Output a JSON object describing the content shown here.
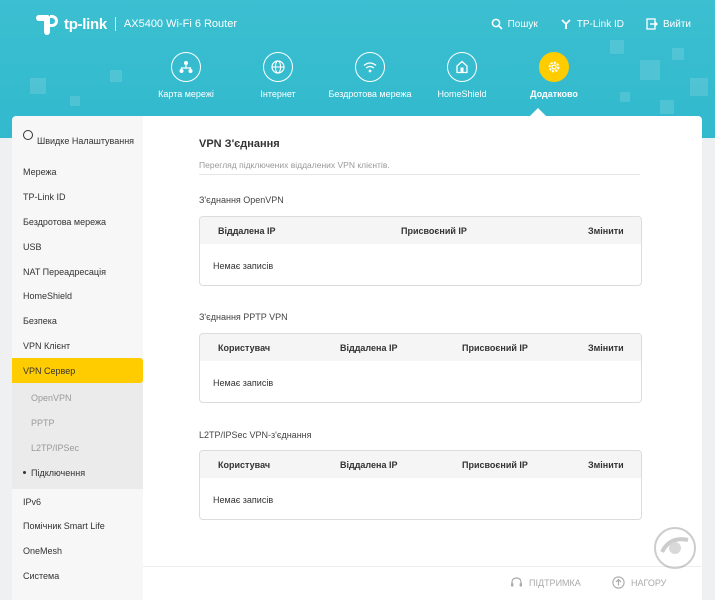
{
  "header": {
    "brand": "tp-link",
    "model": "AX5400 Wi-Fi 6 Router",
    "top_links": [
      {
        "label": "Пошук",
        "icon": "search-icon"
      },
      {
        "label": "TP-Link ID",
        "icon": "tplink-id-icon"
      },
      {
        "label": "Вийти",
        "icon": "logout-icon"
      }
    ],
    "nav": [
      {
        "label": "Карта мережі",
        "icon": "network-map-icon",
        "active": false
      },
      {
        "label": "Інтернет",
        "icon": "globe-icon",
        "active": false
      },
      {
        "label": "Бездротова мережа",
        "icon": "wifi-icon",
        "active": false
      },
      {
        "label": "HomeShield",
        "icon": "homeshield-icon",
        "active": false
      },
      {
        "label": "Додатково",
        "icon": "gear-icon",
        "active": true
      }
    ],
    "colors": {
      "header_bg": "#32b9cd",
      "accent": "#ffcc00"
    }
  },
  "sidebar": {
    "quick_setup": "Швидке Налаштування",
    "items_top": [
      "Мережа",
      "TP-Link ID",
      "Бездротова мережа",
      "USB",
      "NAT Переадресація",
      "HomeShield",
      "Безпека",
      "VPN Клієнт"
    ],
    "active_item": "VPN Сервер",
    "sub_items": [
      "OpenVPN",
      "PPTP",
      "L2TP/IPSec"
    ],
    "current_sub": "Підключення",
    "items_bottom": [
      "IPv6",
      "Помічник Smart Life",
      "OneMesh",
      "Система"
    ]
  },
  "main": {
    "title": "VPN З'єднання",
    "description": "Перегляд підключених віддалених VPN клієнтів.",
    "sections": [
      {
        "label": "З'єднання OpenVPN",
        "columns": [
          "Віддалена IP",
          "Присвоєний IP",
          "Змінити"
        ],
        "empty": "Немає записів"
      },
      {
        "label": "З'єднання PPTP VPN",
        "columns": [
          "Користувач",
          "Віддалена IP",
          "Присвоєний IP",
          "Змінити"
        ],
        "empty": "Немає записів"
      },
      {
        "label": "L2TP/IPSec VPN-з'єднання",
        "columns": [
          "Користувач",
          "Віддалена IP",
          "Присвоєний IP",
          "Змінити"
        ],
        "empty": "Немає записів"
      }
    ]
  },
  "footer": {
    "support": "ПІДТРИМКА",
    "back_to_top": "НАГОРУ"
  }
}
